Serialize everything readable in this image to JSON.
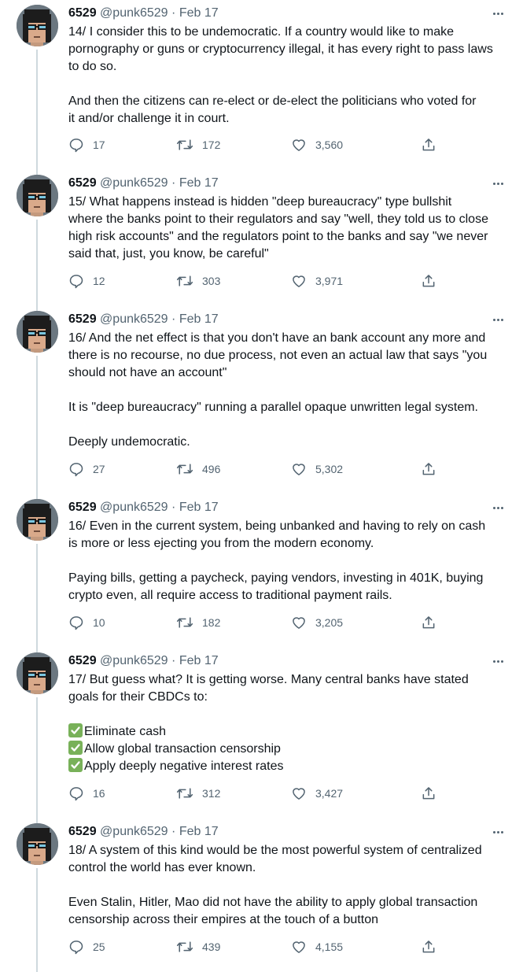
{
  "author": {
    "name": "6529",
    "handle": "@punk6529",
    "separator": "·",
    "date": "Feb 17"
  },
  "tweets": [
    {
      "paragraphs": [
        [
          "14/ I consider this to be undemocratic.  If a country would like to make",
          "pornography or guns or cryptocurrency illegal, it has every right to pass laws",
          "to do so."
        ],
        [
          "And then the citizens can re-elect or de-elect the politicians who voted for",
          "it and/or challenge it in court."
        ]
      ],
      "replies": "17",
      "retweets": "172",
      "likes": "3,560"
    },
    {
      "paragraphs": [
        [
          "15/ What happens instead is hidden \"deep bureaucracy\" type bullshit",
          "where the banks point to their regulators and say \"well, they told us to close",
          "high risk accounts\" and the regulators point to the banks and say \"we never",
          "said that, just, you know, be careful\""
        ]
      ],
      "replies": "12",
      "retweets": "303",
      "likes": "3,971"
    },
    {
      "paragraphs": [
        [
          "16/ And the net effect is that you don't have an bank account any more and",
          "there is no recourse, no due process, not even an actual law that says \"you",
          "should not have an account\""
        ],
        [
          "It is \"deep bureaucracy\" running a parallel opaque unwritten legal system."
        ],
        [
          "Deeply undemocratic."
        ]
      ],
      "replies": "27",
      "retweets": "496",
      "likes": "5,302"
    },
    {
      "paragraphs": [
        [
          "16/ Even in the current system, being unbanked and having to rely on cash",
          "is more or less ejecting you from the modern economy."
        ],
        [
          "Paying bills, getting a paycheck, paying vendors, investing in 401K, buying",
          "crypto even, all require access to traditional payment rails."
        ]
      ],
      "replies": "10",
      "retweets": "182",
      "likes": "3,205"
    },
    {
      "paragraphs": [
        [
          "17/ But guess what? It is getting worse.   Many central banks have stated",
          "goals for their CBDCs to:"
        ]
      ],
      "checklist": [
        "Eliminate cash",
        "Allow global transaction censorship",
        "Apply deeply negative interest rates"
      ],
      "replies": "16",
      "retweets": "312",
      "likes": "3,427"
    },
    {
      "paragraphs": [
        [
          "18/ A system of this kind would be the most powerful system of centralized",
          "control the world has ever known."
        ],
        [
          "Even Stalin, Hitler, Mao did not have the ability to apply global transaction",
          "censorship across their empires at the touch of a button"
        ]
      ],
      "replies": "25",
      "retweets": "439",
      "likes": "4,155"
    }
  ],
  "icons": {
    "reply": "reply-icon",
    "retweet": "retweet-icon",
    "like": "like-icon",
    "share": "share-icon",
    "more": "more-icon",
    "check": "check-mark-icon",
    "avatar": "pixel-punk-avatar"
  },
  "colors": {
    "text": "#0f1419",
    "secondary": "#536471",
    "thread_line": "#cfd9de",
    "check": "#78b159"
  }
}
